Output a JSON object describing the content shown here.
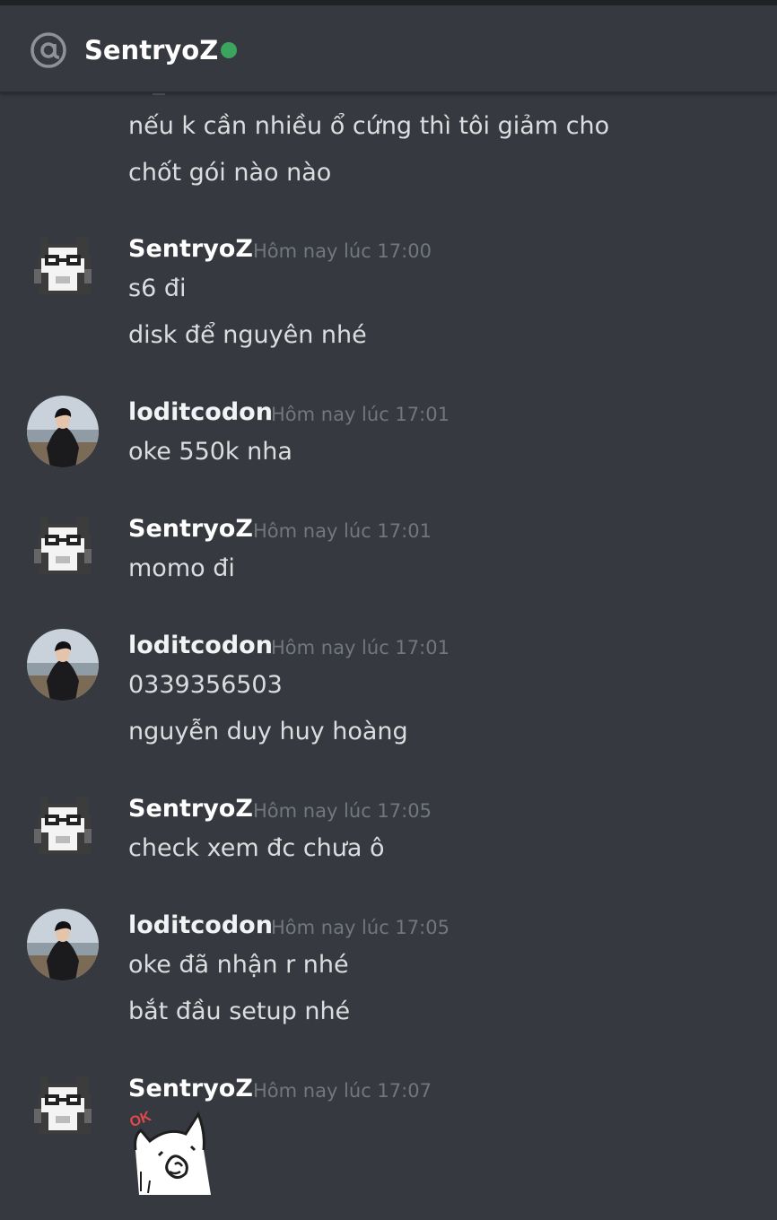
{
  "channel": {
    "title": "SentryoZ",
    "status": "online",
    "icon": "at-sign-icon",
    "status_color": "#3ba55d"
  },
  "colors": {
    "background": "#36393f",
    "text": "#dcddde",
    "timestamp": "#72767d"
  },
  "messages": {
    "g0": {
      "lines": [
        "nếu k cần nhiều ổ cứng thì tôi giảm cho",
        "chốt gói nào nào"
      ]
    },
    "g1": {
      "author": "SentryoZ",
      "timestamp": "Hôm nay lúc 17:00",
      "lines": [
        "s6 đi",
        "disk để nguyên nhé"
      ]
    },
    "g2": {
      "author": "loditcodon",
      "timestamp": "Hôm nay lúc 17:01",
      "lines": [
        "oke 550k nha"
      ]
    },
    "g3": {
      "author": "SentryoZ",
      "timestamp": "Hôm nay lúc 17:01",
      "lines": [
        "momo đi"
      ]
    },
    "g4": {
      "author": "loditcodon",
      "timestamp": "Hôm nay lúc 17:01",
      "lines": [
        "0339356503",
        "nguyễn duy huy hoàng"
      ]
    },
    "g5": {
      "author": "SentryoZ",
      "timestamp": "Hôm nay lúc 17:05",
      "lines": [
        "check xem đc chưa ô"
      ]
    },
    "g6": {
      "author": "loditcodon",
      "timestamp": "Hôm nay lúc 17:05",
      "lines": [
        "oke đã nhận r nhé",
        "bắt đầu setup nhé"
      ]
    },
    "g7": {
      "author": "SentryoZ",
      "timestamp": "Hôm nay lúc 17:07",
      "sticker": {
        "icon": "ok-cat-sticker-icon",
        "text": "OK"
      }
    }
  }
}
